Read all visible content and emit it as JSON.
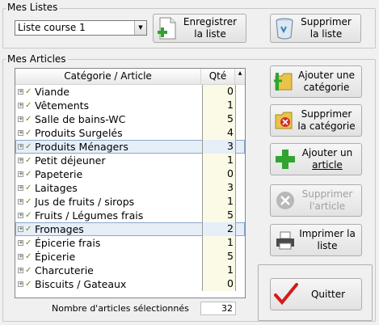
{
  "lists_group": {
    "title": "Mes Listes",
    "selected_list": "Liste course 1",
    "save_label": "Enregistrer\nla liste",
    "delete_label": "Supprimer\nla liste"
  },
  "articles_group": {
    "title": "Mes Articles",
    "col_category": "Catégorie / Article",
    "col_qty": "Qté",
    "rows": [
      {
        "name": "Viande",
        "qty": "0",
        "selected": false
      },
      {
        "name": "Vêtements",
        "qty": "1",
        "selected": false
      },
      {
        "name": "Salle de bains-WC",
        "qty": "5",
        "selected": false
      },
      {
        "name": "Produits Surgelés",
        "qty": "4",
        "selected": false
      },
      {
        "name": "Produits Ménagers",
        "qty": "3",
        "selected": true
      },
      {
        "name": "Petit déjeuner",
        "qty": "1",
        "selected": false
      },
      {
        "name": "Papeterie",
        "qty": "0",
        "selected": false
      },
      {
        "name": "Laitages",
        "qty": "3",
        "selected": false
      },
      {
        "name": "Jus de fruits / sirops",
        "qty": "1",
        "selected": false
      },
      {
        "name": "Fruits / Légumes frais",
        "qty": "5",
        "selected": false
      },
      {
        "name": "Fromages",
        "qty": "2",
        "selected": true
      },
      {
        "name": "Épicerie frais",
        "qty": "1",
        "selected": false
      },
      {
        "name": "Épicerie",
        "qty": "5",
        "selected": false
      },
      {
        "name": "Charcuterie",
        "qty": "1",
        "selected": false
      },
      {
        "name": "Biscuits / Gateaux",
        "qty": "0",
        "selected": false
      }
    ],
    "count_label": "Nombre d'articles sélectionnés",
    "count_value": "32"
  },
  "actions": {
    "add_category": "Ajouter une\ncatégorie",
    "delete_category": "Supprimer\nla catégorie",
    "add_article_line1": "Ajouter un",
    "add_article_line2": "article",
    "delete_article": "Supprimer\nl'article",
    "print_list": "Imprimer la\nliste",
    "quit": "Quitter"
  },
  "colors": {
    "qty_bg": "#fafae6",
    "selected_bg": "#e6eef8",
    "add_green": "#2fa52f",
    "delete_red": "#d03030"
  }
}
